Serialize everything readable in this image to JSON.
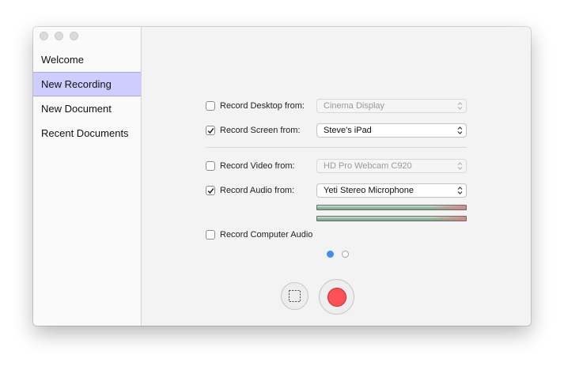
{
  "sidebar": {
    "items": [
      {
        "label": "Welcome"
      },
      {
        "label": "New Recording"
      },
      {
        "label": "New Document"
      },
      {
        "label": "Recent Documents"
      }
    ],
    "selected": "New Recording"
  },
  "options": {
    "desktop": {
      "label": "Record Desktop from:",
      "checked": false,
      "value": "Cinema Display",
      "enabled": false
    },
    "screen": {
      "label": "Record Screen from:",
      "checked": true,
      "value": "Steve's iPad",
      "enabled": true
    },
    "video": {
      "label": "Record Video from:",
      "checked": false,
      "value": "HD Pro Webcam C920",
      "enabled": false
    },
    "audio": {
      "label": "Record Audio from:",
      "checked": true,
      "value": "Yeti Stereo Microphone",
      "enabled": true
    },
    "computer_audio": {
      "label": "Record Computer Audio",
      "checked": false
    }
  },
  "pager": {
    "pages": 2,
    "current": 1
  },
  "colors": {
    "selection": "#cecdfd",
    "record": "#fd5157",
    "page_dot": "#3f8ff0"
  },
  "icons": {
    "area_button": "dashed-square-icon",
    "record_button": "record-dot-icon",
    "popup_arrows": "chevron-up-down-icon"
  }
}
